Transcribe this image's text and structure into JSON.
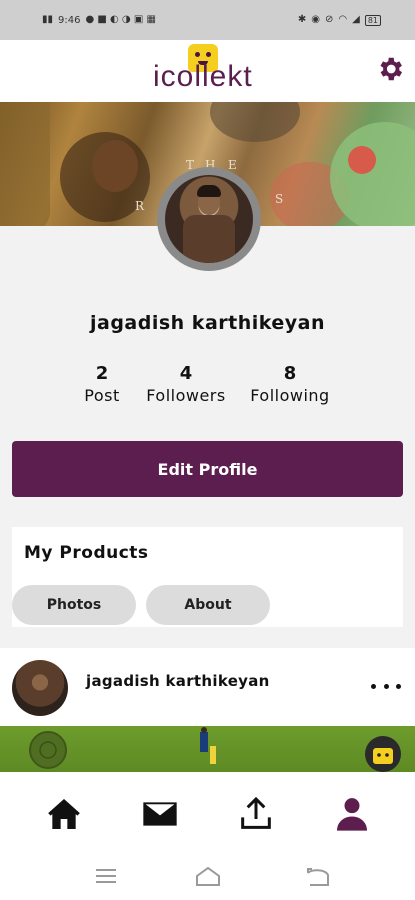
{
  "status_bar": {
    "time": "9:46",
    "battery": "81"
  },
  "app": {
    "logo_text": "icollekt",
    "brand_color": "#5c1d4f"
  },
  "cover": {
    "letters": [
      "T",
      "H",
      "E",
      "R",
      "S"
    ]
  },
  "profile": {
    "name": "jagadish karthikeyan",
    "stats": [
      {
        "value": "2",
        "label": "Post"
      },
      {
        "value": "4",
        "label": "Followers"
      },
      {
        "value": "8",
        "label": "Following"
      }
    ],
    "edit_button_label": "Edit Profile"
  },
  "products": {
    "title": "My Products",
    "tabs": [
      {
        "label": "Photos"
      },
      {
        "label": "About"
      }
    ]
  },
  "post": {
    "username": "jagadish karthikeyan"
  },
  "bottom_nav": {
    "items": [
      {
        "icon": "home-icon"
      },
      {
        "icon": "mail-icon"
      },
      {
        "icon": "upload-icon"
      },
      {
        "icon": "profile-icon",
        "active": true
      }
    ]
  },
  "icons": {
    "settings": "gear-icon",
    "more": "more-horizontal-icon"
  }
}
